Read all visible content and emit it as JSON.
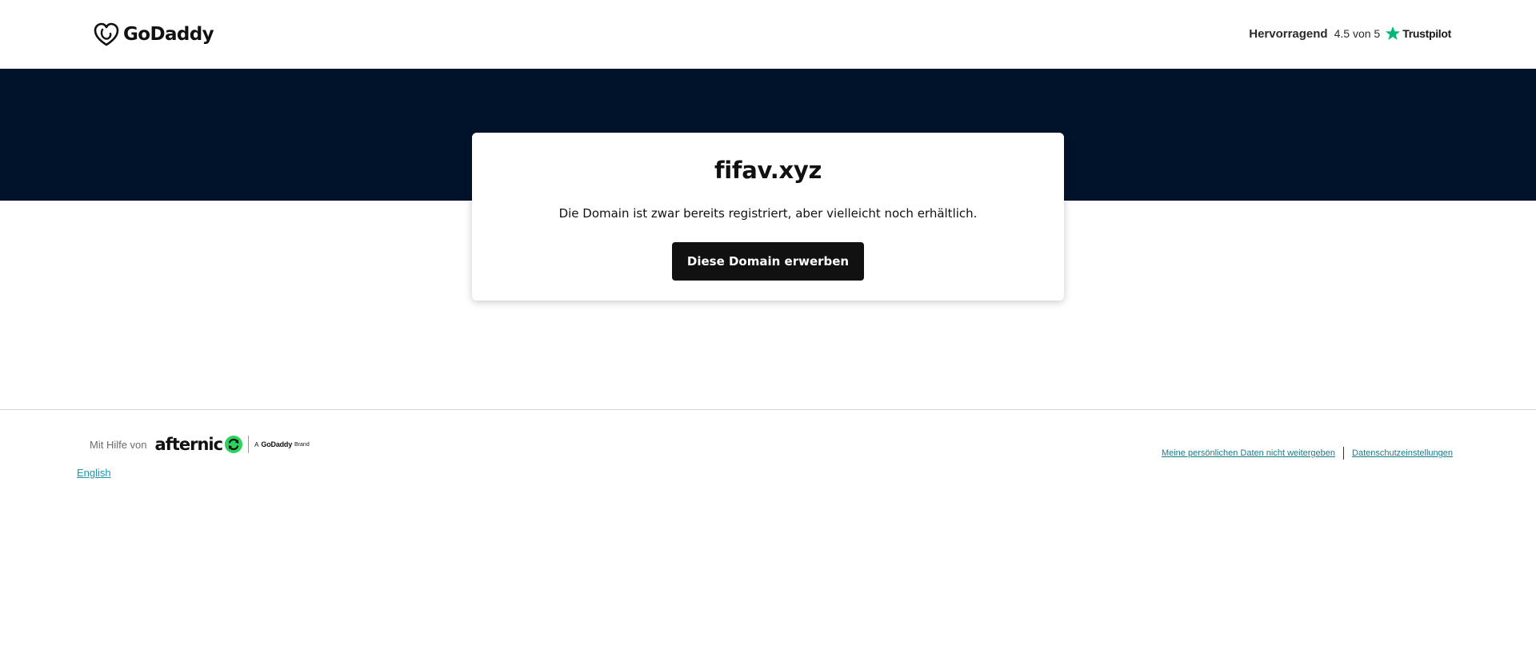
{
  "header": {
    "brand": "GoDaddy",
    "logo_icon": "godaddy-heart-logo",
    "rating_word": "Hervorragend",
    "rating_score": "4.5 von 5",
    "trustpilot_label": "Trustpilot",
    "trustpilot_icon": "star-icon",
    "trustpilot_color": "#00b67a"
  },
  "hero": {
    "band_color": "#00132b"
  },
  "card": {
    "domain": "fifav.xyz",
    "description": "Die Domain ist zwar bereits registriert, aber vielleicht noch erhältlich.",
    "button_label": "Diese Domain erwerben",
    "button_color": "#111111"
  },
  "footer": {
    "powered_label": "Mit Hilfe von",
    "afternic_label": "afternic",
    "afternic_icon": "afternic-refresh-icon",
    "afternic_icon_color": "#2ad35c",
    "brand_prefix": "A",
    "brand_godaddy": "GoDaddy",
    "brand_suffix": "Brand",
    "language_link": "English",
    "links": [
      "Meine persönlichen Daten nicht weitergeben",
      "Datenschutzeinstellungen"
    ],
    "link_color": "#1a7b8a"
  }
}
